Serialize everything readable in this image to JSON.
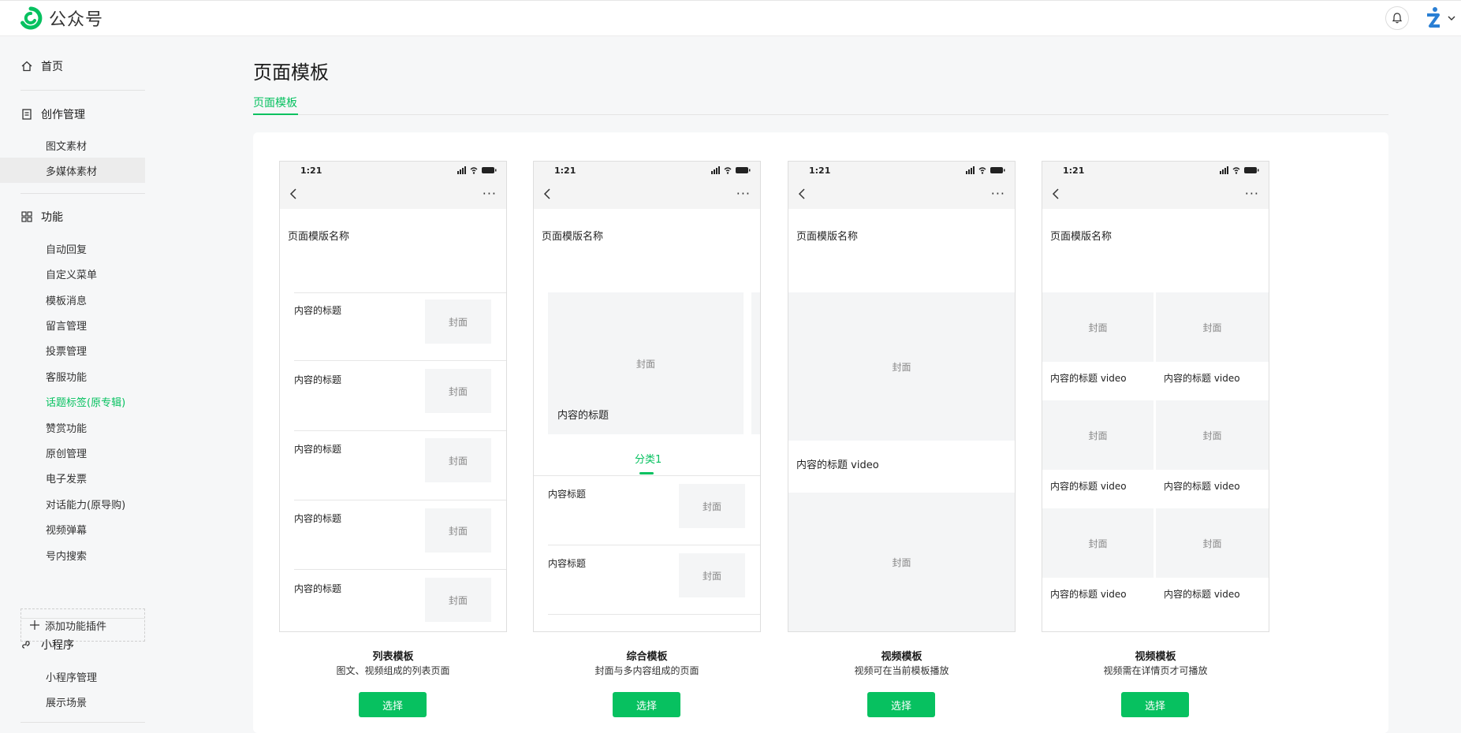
{
  "app": {
    "title": "公众号"
  },
  "sidebar": {
    "home": "首页",
    "create": {
      "label": "创作管理",
      "items": [
        "图文素材",
        "多媒体素材"
      ]
    },
    "features": {
      "label": "功能",
      "items": [
        "自动回复",
        "自定义菜单",
        "模板消息",
        "留言管理",
        "投票管理",
        "客服功能",
        "话题标签(原专辑)",
        "赞赏功能",
        "原创管理",
        "电子发票",
        "对话能力(原导购)",
        "视频弹幕",
        "号内搜索"
      ]
    },
    "add_plugin": "添加功能插件",
    "mini": {
      "label": "小程序",
      "items": [
        "小程序管理",
        "展示场景"
      ]
    }
  },
  "main": {
    "title": "页面模板",
    "tab": "页面模板"
  },
  "phone_common": {
    "time": "1:21",
    "more": "···",
    "page_name": "页面模版名称",
    "cover": "封面"
  },
  "templates": [
    {
      "name": "列表模板",
      "desc": "图文、视频组成的列表页面",
      "button": "选择",
      "content_title": "内容的标题"
    },
    {
      "name": "综合模板",
      "desc": "封面与多内容组成的页面",
      "button": "选择",
      "hero_title": "内容的标题",
      "category": "分类1",
      "content_title": "内容标题"
    },
    {
      "name": "视频模板",
      "desc": "视频可在当前模板播放",
      "button": "选择",
      "content_title": "内容的标题 video"
    },
    {
      "name": "视频模板",
      "desc": "视频需在详情页才可播放",
      "button": "选择",
      "content_title": "内容的标题 video"
    }
  ],
  "colors": {
    "accent": "#07c160",
    "cover_bg": "#f4f5f6",
    "page_bg": "#f6f7f8"
  }
}
